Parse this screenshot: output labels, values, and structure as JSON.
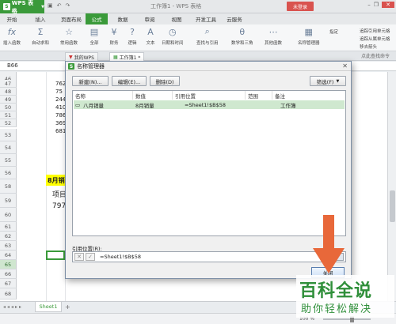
{
  "titlebar": {
    "app_button": "WPS 表格",
    "title": "工作簿1 - WPS 表格",
    "login": "未登录"
  },
  "tabs": [
    "开始",
    "插入",
    "页面布局",
    "公式",
    "数据",
    "审阅",
    "视图",
    "开发工具",
    "云服务"
  ],
  "active_tab": "公式",
  "ribbon": {
    "insert_function": "插入函数",
    "autosum": "自动求和",
    "common_functions": "常用函数",
    "all": "全部",
    "finance": "财务",
    "logic": "逻辑",
    "text": "文本",
    "datetime": "日期和时间",
    "lookup": "查找与引用",
    "math": "数学和三角",
    "other": "其他函数",
    "name_manager": "名称管理器",
    "specify": "指定",
    "trace_precedents": "追踪引用单元格",
    "trace_dependents": "追踪从属单元格",
    "remove_arrows": "移去箭头"
  },
  "doctabs": [
    "我的WPS",
    "工作簿1 *"
  ],
  "search_placeholder": "点此查找命令",
  "namebox": "B66",
  "rows": [
    "46",
    "47",
    "48",
    "49",
    "50",
    "51",
    "52",
    "53",
    "54",
    "55",
    "56",
    "57",
    "58",
    "59",
    "60",
    "61",
    "62",
    "63",
    "64",
    "65",
    "66",
    "67",
    "68"
  ],
  "cells": {
    "r46": "762",
    "r47": "75",
    "r48": "244",
    "r49": "410",
    "r50": "786",
    "r51": "369",
    "r52": "681",
    "r58": "8月销",
    "r59": "项目",
    "r60": "797"
  },
  "sheet_tab": "Sheet1",
  "zoom": "100 %",
  "dialog": {
    "title": "名称管理器",
    "new_button": "新建(N)...",
    "edit_button": "编辑(E)...",
    "delete_button": "删除(D)",
    "filter_button": "筛选(F)",
    "columns": [
      "名称",
      "数值",
      "引用位置",
      "范围",
      "备注"
    ],
    "rows": [
      {
        "name": "八月销量",
        "value": "8月销量",
        "ref": "=Sheet1!$B$58",
        "scope": "工作簿",
        "note": ""
      }
    ],
    "ref_label": "引用位置(R):",
    "ref_value": "=Sheet1!$B$58",
    "close_button": "关闭"
  },
  "watermark": {
    "line1": "百科全说",
    "line2": "助你轻松解决"
  },
  "colors": {
    "accent_green": "#3a9a3a",
    "arrow_orange": "#e8683a",
    "highlight_yellow": "#ffff00"
  }
}
